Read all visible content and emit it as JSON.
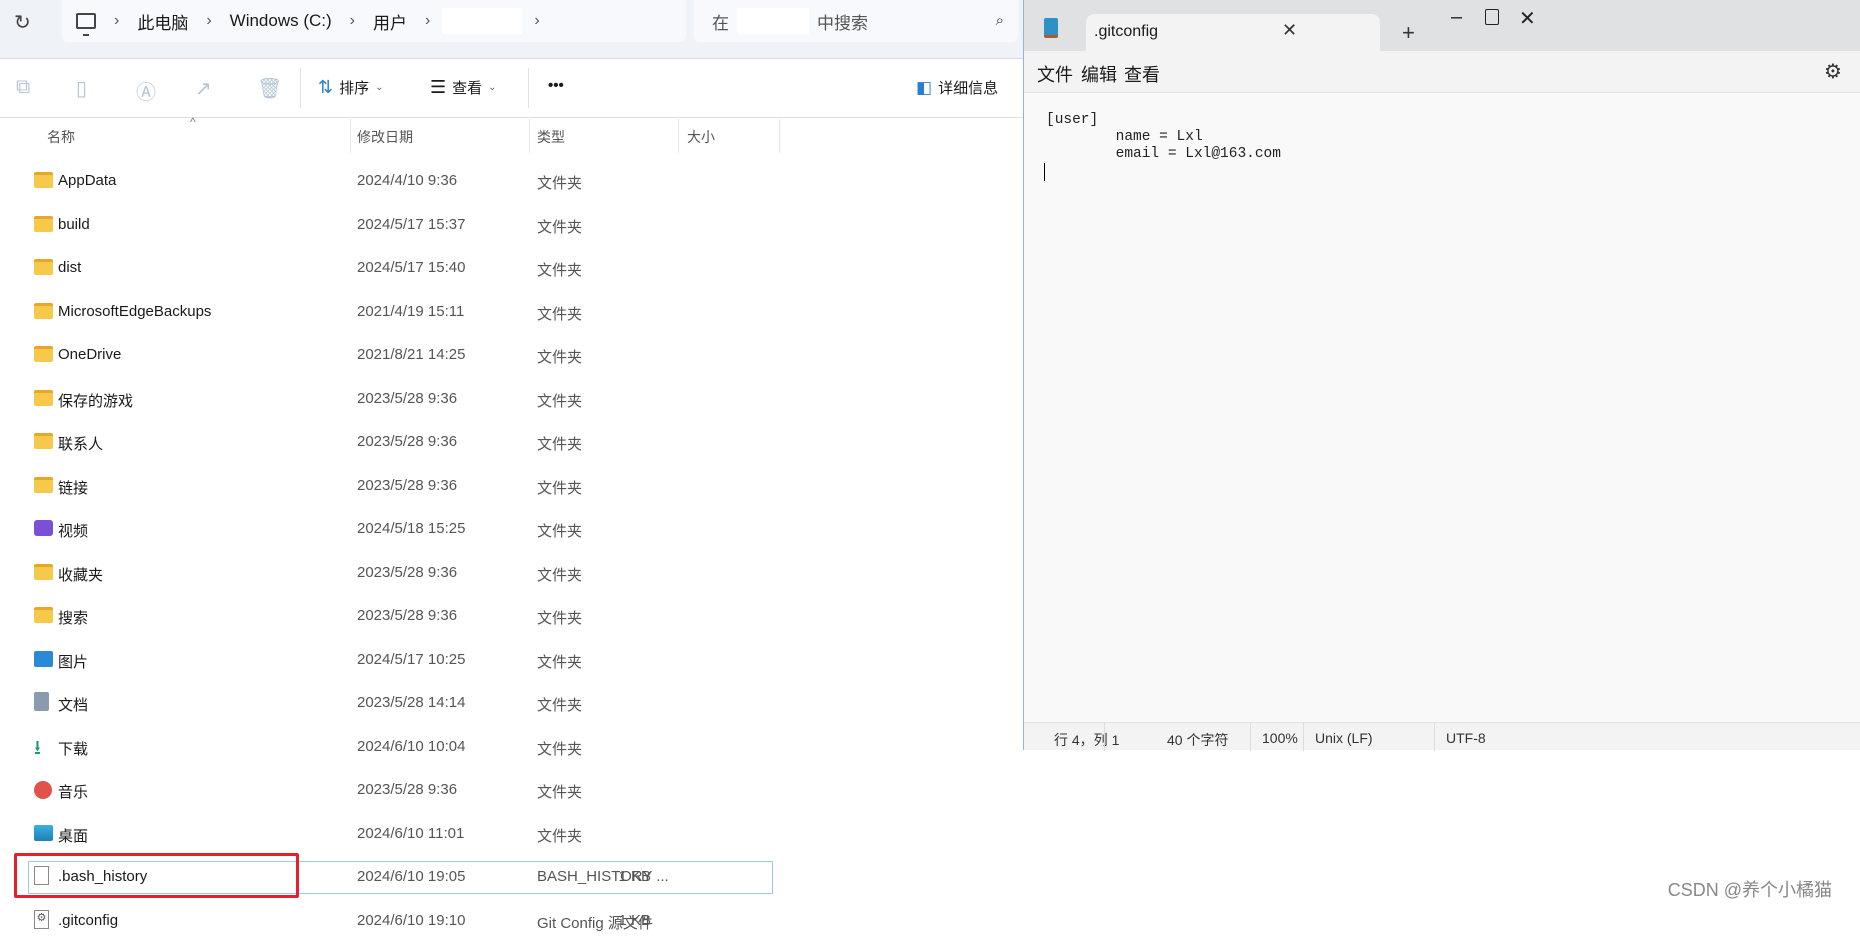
{
  "explorer": {
    "breadcrumb": [
      "此电脑",
      "Windows (C:)",
      "用户"
    ],
    "search_prefix": "在",
    "search_suffix": "中搜索",
    "toolbar": {
      "sort": "排序",
      "view": "查看",
      "more": "•••",
      "details": "详细信息"
    },
    "columns": {
      "name": "名称",
      "date": "修改日期",
      "type": "类型",
      "size": "大小"
    },
    "rows": [
      {
        "name": "AppData",
        "date": "2024/4/10 9:36",
        "type": "文件夹",
        "size": "",
        "icon": "folder-icon"
      },
      {
        "name": "build",
        "date": "2024/5/17 15:37",
        "type": "文件夹",
        "size": "",
        "icon": "folder-icon"
      },
      {
        "name": "dist",
        "date": "2024/5/17 15:40",
        "type": "文件夹",
        "size": "",
        "icon": "folder-icon"
      },
      {
        "name": "MicrosoftEdgeBackups",
        "date": "2021/4/19 15:11",
        "type": "文件夹",
        "size": "",
        "icon": "folder-icon"
      },
      {
        "name": "OneDrive",
        "date": "2021/8/21 14:25",
        "type": "文件夹",
        "size": "",
        "icon": "folder-icon"
      },
      {
        "name": "保存的游戏",
        "date": "2023/5/28 9:36",
        "type": "文件夹",
        "size": "",
        "icon": "folder-icon"
      },
      {
        "name": "联系人",
        "date": "2023/5/28 9:36",
        "type": "文件夹",
        "size": "",
        "icon": "folder-icon"
      },
      {
        "name": "链接",
        "date": "2023/5/28 9:36",
        "type": "文件夹",
        "size": "",
        "icon": "folder-icon"
      },
      {
        "name": "视频",
        "date": "2024/5/18 15:25",
        "type": "文件夹",
        "size": "",
        "icon": "video-icon"
      },
      {
        "name": "收藏夹",
        "date": "2023/5/28 9:36",
        "type": "文件夹",
        "size": "",
        "icon": "folder-icon"
      },
      {
        "name": "搜索",
        "date": "2023/5/28 9:36",
        "type": "文件夹",
        "size": "",
        "icon": "folder-icon"
      },
      {
        "name": "图片",
        "date": "2024/5/17 10:25",
        "type": "文件夹",
        "size": "",
        "icon": "pictures-icon"
      },
      {
        "name": "文档",
        "date": "2023/5/28 14:14",
        "type": "文件夹",
        "size": "",
        "icon": "documents-icon"
      },
      {
        "name": "下载",
        "date": "2024/6/10 10:04",
        "type": "文件夹",
        "size": "",
        "icon": "downloads-icon"
      },
      {
        "name": "音乐",
        "date": "2023/5/28 9:36",
        "type": "文件夹",
        "size": "",
        "icon": "music-icon"
      },
      {
        "name": "桌面",
        "date": "2024/6/10 11:01",
        "type": "文件夹",
        "size": "",
        "icon": "desktop-icon"
      },
      {
        "name": ".bash_history",
        "date": "2024/6/10 19:05",
        "type": "BASH_HISTORY ...",
        "size": "1 KB",
        "icon": "file-icon"
      },
      {
        "name": ".gitconfig",
        "date": "2024/6/10 19:10",
        "type": "Git Config 源文件",
        "size": "1 KB",
        "icon": "config-file-icon",
        "selected": true
      }
    ]
  },
  "notepad": {
    "tab_title": ".gitconfig",
    "menu": [
      "文件",
      "编辑",
      "查看"
    ],
    "content": "[user]\n\tname = Lxl\n\temail = Lxl@163.com",
    "status": {
      "position": "行 4，列 1",
      "chars": "40 个字符",
      "zoom": "100%",
      "line_ending": "Unix (LF)",
      "encoding": "UTF-8"
    }
  },
  "watermark": "CSDN @养个小橘猫",
  "colors": {
    "highlight": "#e4212b",
    "selection_border": "#99c9ef",
    "folder": "#f7c94a"
  }
}
